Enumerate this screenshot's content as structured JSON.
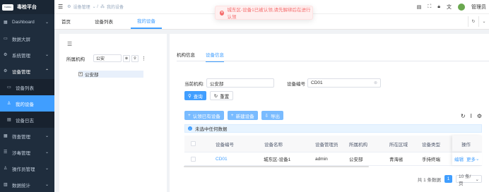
{
  "app": {
    "logo_badge": "TERRA",
    "title": "毒检平台"
  },
  "sidebar": {
    "items": [
      {
        "label": "Dashboard",
        "icon": "dashboard-icon"
      },
      {
        "label": "数据大屏",
        "icon": "monitor-icon"
      },
      {
        "label": "系统管理",
        "icon": "gear-icon"
      },
      {
        "label": "设备管理",
        "icon": "gear-icon"
      },
      {
        "label": "设备列表",
        "icon": "list-icon"
      },
      {
        "label": "我的设备",
        "icon": "user-icon"
      },
      {
        "label": "设备日志",
        "icon": "log-icon"
      },
      {
        "label": "筛查管理",
        "icon": "grid-icon"
      },
      {
        "label": "涉毒管理",
        "icon": "list-icon"
      },
      {
        "label": "操作员管理",
        "icon": "person-icon"
      },
      {
        "label": "数据统计",
        "icon": "chart-icon"
      }
    ]
  },
  "navbar": {
    "breadcrumb": [
      "设备管理",
      "我的设备"
    ],
    "user_name": "管理员"
  },
  "tags": [
    "首页",
    "设备列表",
    "我的设备"
  ],
  "toast": {
    "message": "城东区-设备1已被认领,请先解绑后在进行认领"
  },
  "left": {
    "filter_label": "所属机构",
    "filter_value": "公安",
    "tree_root": "公安部"
  },
  "right": {
    "tabs": [
      "机构信息",
      "设备信息"
    ],
    "form": {
      "org_label": "当前机构:",
      "org_value": "公安部",
      "device_no_label": "设备编号",
      "device_no_value": "CD01",
      "search_btn": "查询",
      "reset_btn": "重置"
    },
    "actions": {
      "claim": "认领已有设备",
      "add": "新建设备",
      "export": "导出"
    },
    "alert": "未选中任何数据",
    "table": {
      "headers": [
        "设备编号",
        "设备名称",
        "设备管理员",
        "所属机构",
        "所在区域",
        "设备类型",
        "设备",
        "操作"
      ],
      "rows": [
        [
          "CD01",
          "城东区-设备1",
          "admin",
          "公安部",
          "青海省",
          "手持终端",
          "启用",
          "编辑",
          "更多"
        ]
      ]
    },
    "pager": {
      "total": "共 1 条数据",
      "current": "1",
      "page_size": "10 条/页"
    }
  },
  "colors": {
    "primary": "#409eff",
    "sidebar": "#1f2d3d",
    "error": "#f56c6c"
  }
}
